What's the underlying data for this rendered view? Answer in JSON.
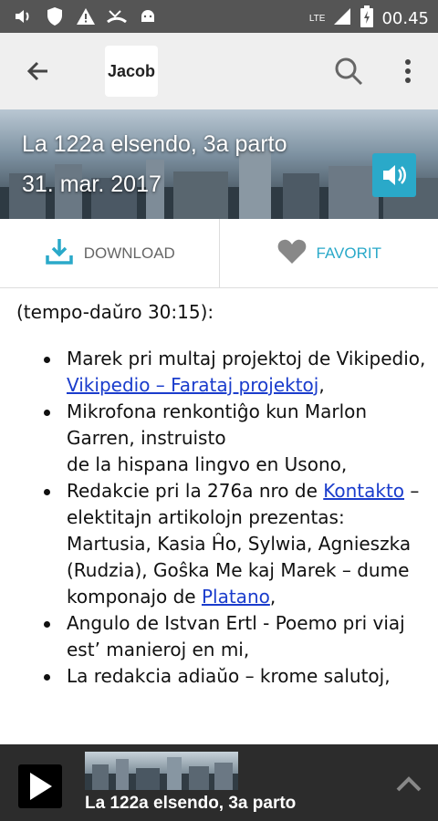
{
  "status_bar": {
    "time": "00.45",
    "network": "LTE",
    "icons": [
      "volume-icon",
      "shield-icon",
      "warning-icon",
      "missed-call-icon",
      "android-icon",
      "signal-icon",
      "battery-icon"
    ]
  },
  "toolbar": {
    "app_name": "Jacob",
    "icons": [
      "back-arrow-icon",
      "search-icon",
      "more-vert-icon"
    ]
  },
  "episode": {
    "title": "La 122a elsendo, 3a parto",
    "date": "31. mar. 2017"
  },
  "actions": {
    "download_label": "DOWNLOAD",
    "favorite_label": "FAVORIT"
  },
  "content": {
    "intro": "(tempo-daŭro 30:15):",
    "items": [
      {
        "t1": "Marek pri multaj projektoj de Vikipedio,",
        "link": "Vikipedio –  Farataj projektoj",
        "t2": ","
      },
      {
        "t1": "Mikrofona renkontiĝo kun Marlon Garren, instruisto",
        "t2": "de la hispana lingvo en Usono,"
      },
      {
        "t1": "Redakcie pri la 276a nro de ",
        "link": "Kontakto",
        "t2": " – elektitajn artikolojn prezentas: Martusia, Kasia Ĥo, Sylwia, Agnieszka (Rudzia), Goŝka Me kaj Marek – dume komponajo de ",
        "link2": "Platano",
        "t3": ","
      },
      {
        "t1": "Angulo de Istvan Ertl  - Poemo pri viaj est’ manieroj en mi,"
      },
      {
        "t1": "La redakcia adiaŭo – krome salutoj,"
      }
    ]
  },
  "player": {
    "title": "La 122a elsendo, 3a parto"
  },
  "colors": {
    "accent": "#2aa9c9",
    "status_bar": "#555555",
    "toolbar": "#efefef",
    "player": "#2c2c2c",
    "link": "#1a3ccc"
  }
}
